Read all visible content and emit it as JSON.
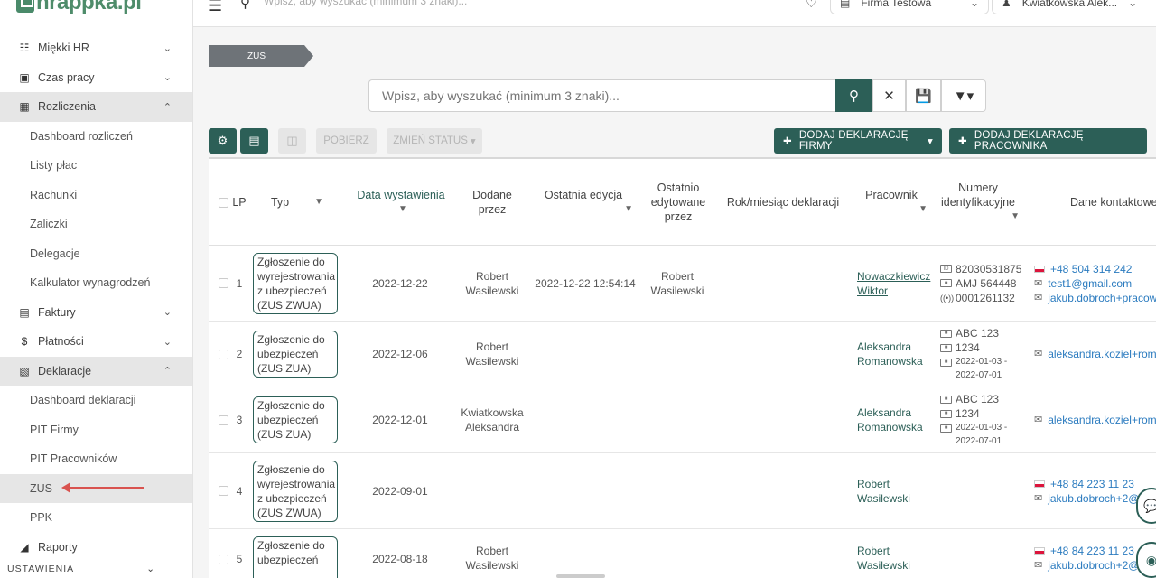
{
  "brand": {
    "logo_text": "hrappka.pl"
  },
  "topbar": {
    "search_placeholder": "Wpisz, aby wyszukać (minimum 3 znaki)...",
    "company": "Firma Testowa",
    "user": "Kwiatkowska Alek..."
  },
  "sidebar": {
    "items": [
      {
        "label": "Miękki HR",
        "icon": "person-card-icon"
      },
      {
        "label": "Czas pracy",
        "icon": "briefcase-icon"
      },
      {
        "label": "Rozliczenia",
        "icon": "calculator-icon"
      },
      {
        "label": "Dashboard rozliczeń"
      },
      {
        "label": "Listy płac"
      },
      {
        "label": "Rachunki"
      },
      {
        "label": "Zaliczki"
      },
      {
        "label": "Delegacje"
      },
      {
        "label": "Kalkulator wynagrodzeń"
      },
      {
        "label": "Faktury",
        "icon": "document-icon"
      },
      {
        "label": "Płatności",
        "icon": "dollar-icon"
      },
      {
        "label": "Deklaracje",
        "icon": "folder-person-icon"
      },
      {
        "label": "Dashboard deklaracji"
      },
      {
        "label": "PIT Firmy"
      },
      {
        "label": "PIT Pracowników"
      },
      {
        "label": "ZUS"
      },
      {
        "label": "PPK"
      },
      {
        "label": "Raporty",
        "icon": "chart-icon"
      },
      {
        "label": "USTAWIENIA"
      }
    ]
  },
  "breadcrumb": {
    "current": "ZUS"
  },
  "search": {
    "placeholder": "Wpisz, aby wyszukać (minimum 3 znaki)..."
  },
  "toolbar": {
    "pobierz": "POBIERZ",
    "zmien_status": "ZMIEŃ STATUS",
    "add_company": "DODAJ DEKLARACJĘ FIRMY",
    "add_employee": "DODAJ DEKLARACJĘ PRACOWNIKA"
  },
  "table": {
    "headers": {
      "lp": "LP",
      "typ": "Typ",
      "data": "Data wystawienia",
      "dodane_1": "Dodane",
      "dodane_2": "przez",
      "edycja": "Ostatnia edycja",
      "ostatnio_1": "Ostatnio",
      "ostatnio_2": "edytowane",
      "ostatnio_3": "przez",
      "rok": "Rok/miesiąc deklaracji",
      "pracownik": "Pracownik",
      "numery_1": "Numery",
      "numery_2": "identyfikacyjne",
      "kontakt": "Dane kontaktowe"
    },
    "rows": [
      {
        "lp": "1",
        "typ": [
          "Zgłoszenie do",
          "wyrejestrowania",
          "z ubezpieczeń",
          "(ZUS ZWUA)"
        ],
        "data": "2022-12-22",
        "dodane": [
          "Robert",
          "Wasilewski"
        ],
        "edycja": "2022-12-22 12:54:14",
        "ostatnio": [
          "Robert",
          "Wasilewski"
        ],
        "pracownik": [
          "Nowaczkiewicz",
          "Wiktor"
        ],
        "ids": [
          "82030531875",
          "AMJ 564448",
          "0001261132"
        ],
        "kontakt": [
          "+48 504 314 242",
          "test1@gmail.com",
          "jakub.dobroch+pracow"
        ]
      },
      {
        "lp": "2",
        "typ": [
          "Zgłoszenie do",
          "ubezpieczeń",
          "(ZUS ZUA)"
        ],
        "data": "2022-12-06",
        "dodane": [
          "Robert",
          "Wasilewski"
        ],
        "pracownik": [
          "Aleksandra",
          "Romanowska"
        ],
        "ids": [
          "ABC 123",
          "1234",
          "2022-01-03 -",
          "2022-07-01"
        ],
        "kontakt": [
          "aleksandra.koziel+roma"
        ]
      },
      {
        "lp": "3",
        "typ": [
          "Zgłoszenie do",
          "ubezpieczeń",
          "(ZUS ZUA)"
        ],
        "data": "2022-12-01",
        "dodane": [
          "Kwiatkowska",
          "Aleksandra"
        ],
        "pracownik": [
          "Aleksandra",
          "Romanowska"
        ],
        "ids": [
          "ABC 123",
          "1234",
          "2022-01-03 -",
          "2022-07-01"
        ],
        "kontakt": [
          "aleksandra.koziel+roma"
        ]
      },
      {
        "lp": "4",
        "typ": [
          "Zgłoszenie do",
          "wyrejestrowania",
          "z ubezpieczeń",
          "(ZUS ZWUA)"
        ],
        "data": "2022-09-01",
        "pracownik": [
          "Robert",
          "Wasilewski"
        ],
        "kontakt": [
          "+48 84 223 11 23",
          "jakub.dobroch+2@"
        ]
      },
      {
        "lp": "5",
        "typ": [
          "Zgłoszenie do",
          "ubezpieczeń"
        ],
        "data": "2022-08-18",
        "dodane": [
          "Robert",
          "Wasilewski"
        ],
        "pracownik": [
          "Robert",
          "Wasilewski"
        ],
        "kontakt": [
          "+48 84 223 11 23",
          "jakub.dobroch+2@"
        ]
      }
    ]
  }
}
